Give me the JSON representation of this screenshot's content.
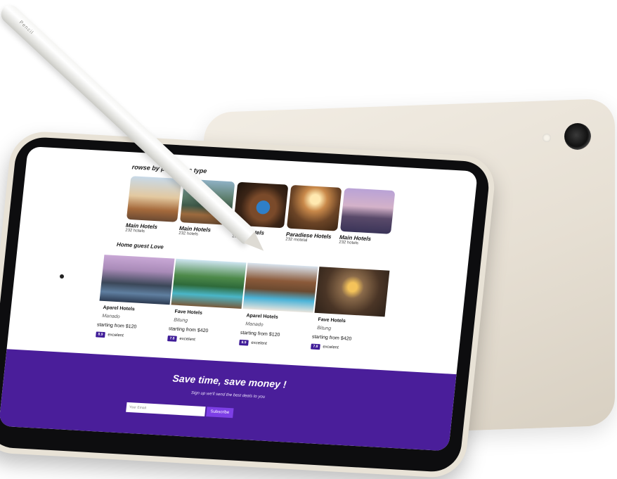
{
  "page": {
    "section_browse": "rowse by properties type",
    "section_guests": "Home guest Love"
  },
  "properties": [
    {
      "name": "Main Hotels",
      "count": "232 hotels",
      "image": "resort-pool-image"
    },
    {
      "name": "Main Hotels",
      "count": "232 hotels",
      "image": "mountain-lake-image"
    },
    {
      "name": "Main Hotels",
      "count": "232 hotels",
      "image": "bedroom-towel-image"
    },
    {
      "name": "Paradiese Hotels",
      "count": "232 motelal",
      "image": "lobby-image"
    },
    {
      "name": "Main Hotels",
      "count": "232 hotels",
      "image": "palm-resort-image"
    }
  ],
  "guests": [
    {
      "name": "Aparel Hotels",
      "location": "Manado",
      "price": "starting from $120",
      "score": "8.9",
      "rating_label": "excelent"
    },
    {
      "name": "Fave Hotels",
      "location": "Bitung",
      "price": "starting from $420",
      "score": "7.8",
      "rating_label": "excelent"
    },
    {
      "name": "Aparel Hotels",
      "location": "Manado",
      "price": "starting from $120",
      "score": "8.9",
      "rating_label": "excelent"
    },
    {
      "name": "Fave Hotels",
      "location": "Bitung",
      "price": "starting from $420",
      "score": "7.8",
      "rating_label": "excelent"
    }
  ],
  "footer": {
    "title": "Save time, save money !",
    "subtitle": "Sign up we'll send the best deals to you",
    "email_placeholder": "Your Email",
    "subscribe_label": "Subscribe"
  },
  "pencil": {
    "brand": "Pencil"
  },
  "colors": {
    "accent": "#4a1e9a",
    "badge": "#3f1c98",
    "button": "#7d3fe6",
    "device": "#e8e2d6"
  }
}
